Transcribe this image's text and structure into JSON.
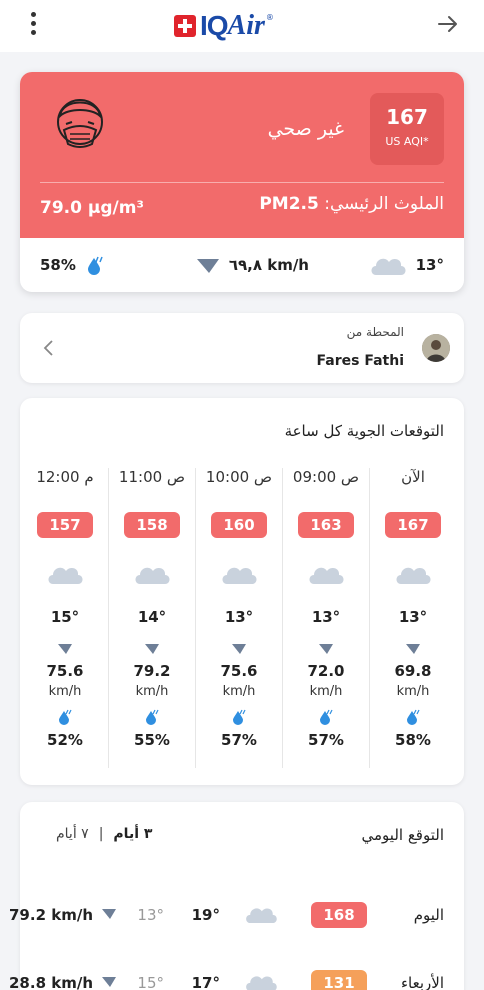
{
  "header": {
    "logo_iq": "IQ",
    "logo_air": "Air",
    "logo_mark": "®"
  },
  "aqi": {
    "value": "167",
    "unit": "US AQI*",
    "status": "غير صحي",
    "pollutant_label": "الملوث الرئيسي:",
    "pollutant_name": "PM2.5",
    "concentration": "79.0 µg/m³",
    "temperature": "13°",
    "wind": "٦٩,٨ km/h",
    "humidity": "58%",
    "colors": {
      "card": "#f26b6b",
      "box": "#e35a5a"
    }
  },
  "station": {
    "from_label": "المحطة من",
    "name": "Fares Fathi"
  },
  "hourly": {
    "title": "التوقعات الجوية كل ساعة",
    "columns": [
      {
        "time": "الآن",
        "aqi": "167",
        "temp": "13°",
        "wind": "69.8",
        "wind_unit": "km/h",
        "humidity": "58%"
      },
      {
        "time": "09:00 ص",
        "aqi": "163",
        "temp": "13°",
        "wind": "72.0",
        "wind_unit": "km/h",
        "humidity": "57%"
      },
      {
        "time": "10:00 ص",
        "aqi": "160",
        "temp": "13°",
        "wind": "75.6",
        "wind_unit": "km/h",
        "humidity": "57%"
      },
      {
        "time": "11:00 ص",
        "aqi": "158",
        "temp": "14°",
        "wind": "79.2",
        "wind_unit": "km/h",
        "humidity": "55%"
      },
      {
        "time": "12:00 م",
        "aqi": "157",
        "temp": "15°",
        "wind": "75.6",
        "wind_unit": "km/h",
        "humidity": "52%"
      }
    ]
  },
  "daily": {
    "title": "التوقع اليومي",
    "tab_3": "٣ أيام",
    "separator": "|",
    "tab_7": "٧ أيام",
    "rows": [
      {
        "day": "اليوم",
        "aqi": "168",
        "aqi_color": "#f26b6b",
        "high": "19°",
        "low": "13°",
        "wind": "79.2 km/h"
      },
      {
        "day": "الأربعاء",
        "aqi": "131",
        "aqi_color": "#f5a05a",
        "high": "17°",
        "low": "15°",
        "wind": "28.8 km/h"
      }
    ]
  }
}
